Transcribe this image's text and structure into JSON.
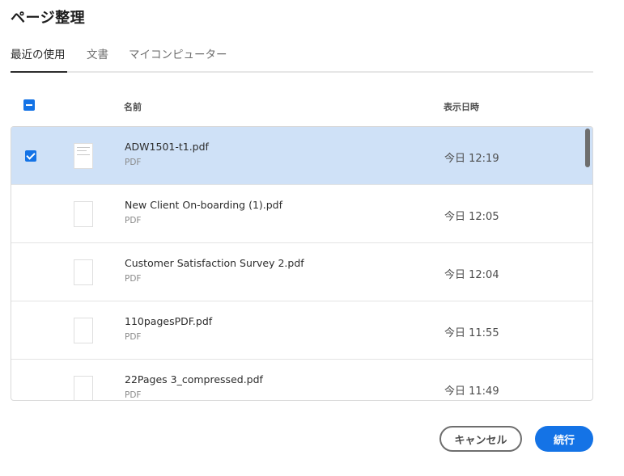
{
  "dialog": {
    "title": "ページ整理"
  },
  "tabs": [
    {
      "label": "最近の使用"
    },
    {
      "label": "文書"
    },
    {
      "label": "マイコンピューター"
    }
  ],
  "table": {
    "headers": {
      "name": "名前",
      "date": "表示日時"
    },
    "rows": [
      {
        "name": "ADW1501-t1.pdf",
        "type": "PDF",
        "date": "今日 12:19",
        "selected": true
      },
      {
        "name": "New Client On-boarding (1).pdf",
        "type": "PDF",
        "date": "今日 12:05",
        "selected": false
      },
      {
        "name": "Customer Satisfaction Survey 2.pdf",
        "type": "PDF",
        "date": "今日 12:04",
        "selected": false
      },
      {
        "name": "110pagesPDF.pdf",
        "type": "PDF",
        "date": "今日 11:55",
        "selected": false
      },
      {
        "name": "22Pages 3_compressed.pdf",
        "type": "PDF",
        "date": "今日 11:49",
        "selected": false
      }
    ]
  },
  "buttons": {
    "cancel": "キャンセル",
    "continue": "続行"
  },
  "colors": {
    "accent": "#1473e6",
    "selected_row": "#cfe1f7"
  }
}
